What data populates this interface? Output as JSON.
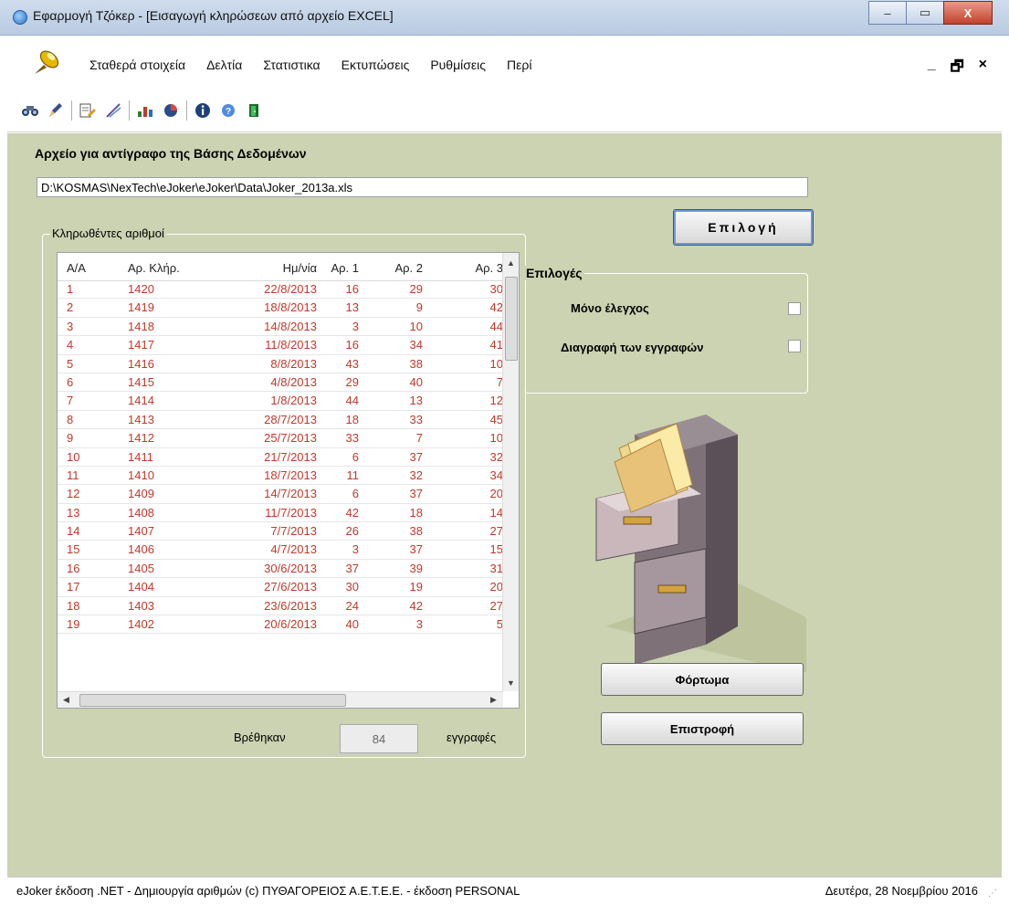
{
  "window": {
    "title": "Εφαρμογή Τζόκερ - [Εισαγωγή κληρώσεων από αρχείο EXCEL]",
    "min": "–",
    "max": "▭",
    "close": "X"
  },
  "menu": {
    "items": [
      "Σταθερά στοιχεία",
      "Δελτία",
      "Στατιστικα",
      "Εκτυπώσεις",
      "Ρυθμίσεις",
      "Περί"
    ],
    "mdi_min": "_",
    "mdi_restore": "🗗",
    "mdi_close": "×"
  },
  "form": {
    "archive_label": "Αρχείο για αντίγραφο της Βάσης Δεδομένων",
    "path": "D:\\KOSMAS\\NexTech\\eJoker\\eJoker\\Data\\Joker_2013a.xls",
    "select_button": "Επιλογή",
    "drawn_group": "Κληρωθέντες αριθμοί",
    "options_group": "Επιλογές",
    "option_check_only": "Μόνο έλεγχος",
    "option_delete": "Διαγραφή των εγγραφών",
    "found_label": "Βρέθηκαν",
    "found_count": "84",
    "records_label": "εγγραφές",
    "load_button": "Φόρτωμα",
    "back_button": "Επιστροφή"
  },
  "grid": {
    "headers": [
      "Α/Α",
      "Αρ. Κλήρ.",
      "Ημ/νία",
      "Αρ. 1",
      "Αρ. 2",
      "Αρ. 3"
    ],
    "rows": [
      [
        "1",
        "1420",
        "22/8/2013",
        "16",
        "29",
        "30"
      ],
      [
        "2",
        "1419",
        "18/8/2013",
        "13",
        "9",
        "42"
      ],
      [
        "3",
        "1418",
        "14/8/2013",
        "3",
        "10",
        "44"
      ],
      [
        "4",
        "1417",
        "11/8/2013",
        "16",
        "34",
        "41"
      ],
      [
        "5",
        "1416",
        "8/8/2013",
        "43",
        "38",
        "10"
      ],
      [
        "6",
        "1415",
        "4/8/2013",
        "29",
        "40",
        "7"
      ],
      [
        "7",
        "1414",
        "1/8/2013",
        "44",
        "13",
        "12"
      ],
      [
        "8",
        "1413",
        "28/7/2013",
        "18",
        "33",
        "45"
      ],
      [
        "9",
        "1412",
        "25/7/2013",
        "33",
        "7",
        "10"
      ],
      [
        "10",
        "1411",
        "21/7/2013",
        "6",
        "37",
        "32"
      ],
      [
        "11",
        "1410",
        "18/7/2013",
        "11",
        "32",
        "34"
      ],
      [
        "12",
        "1409",
        "14/7/2013",
        "6",
        "37",
        "20"
      ],
      [
        "13",
        "1408",
        "11/7/2013",
        "42",
        "18",
        "14"
      ],
      [
        "14",
        "1407",
        "7/7/2013",
        "26",
        "38",
        "27"
      ],
      [
        "15",
        "1406",
        "4/7/2013",
        "3",
        "37",
        "15"
      ],
      [
        "16",
        "1405",
        "30/6/2013",
        "37",
        "39",
        "31"
      ],
      [
        "17",
        "1404",
        "27/6/2013",
        "30",
        "19",
        "20"
      ],
      [
        "18",
        "1403",
        "23/6/2013",
        "24",
        "42",
        "27"
      ],
      [
        "19",
        "1402",
        "20/6/2013",
        "40",
        "3",
        "5"
      ]
    ]
  },
  "status": {
    "left": "eJoker έκδοση .NET  - Δημιουργία αριθμών  (c) ΠΥΘΑΓΟΡΕΙΟΣ  Α.Ε.Τ.Ε.Ε.  - έκδοση PERSONAL",
    "right": "Δευτέρα, 28 Νοεμβρίου 2016"
  },
  "icons": {
    "toolbar": [
      "binoculars-icon",
      "pen-icon",
      "edit-icon",
      "brush-icon",
      "chart-icon",
      "pie-icon",
      "info-icon",
      "help-icon",
      "exit-icon"
    ]
  },
  "colors": {
    "client_bg": "#ccd3b2",
    "grid_text": "#c0392b"
  }
}
